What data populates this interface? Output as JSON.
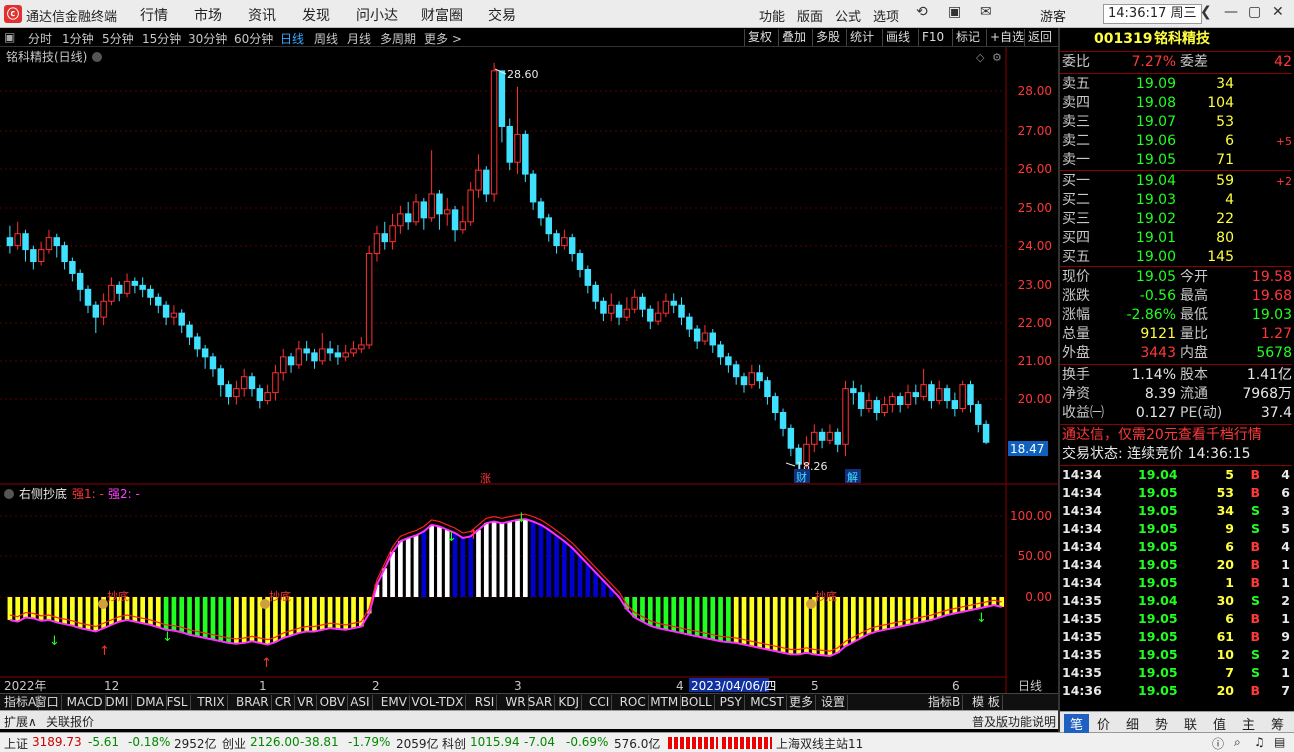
{
  "titlebar": {
    "app_title": "通达信金融终端",
    "menus": [
      "行情",
      "市场",
      "资讯",
      "发现",
      "问小达",
      "财富圈",
      "交易"
    ],
    "right_menus": [
      "功能",
      "版面",
      "公式",
      "选项"
    ],
    "user": "游客",
    "clock": "14:36:17 周三"
  },
  "period_bar": {
    "items": [
      "分时",
      "1分钟",
      "5分钟",
      "15分钟",
      "30分钟",
      "60分钟",
      "日线",
      "周线",
      "月线",
      "多周期",
      "更多 >"
    ],
    "active": "日线",
    "tools": [
      "复权",
      "叠加",
      "多股",
      "统计",
      "画线",
      "F10",
      "标记",
      "+自选",
      "返回"
    ]
  },
  "chart": {
    "stock_title": "铭科精技(日线)",
    "price_axis": [
      "28.00",
      "27.00",
      "26.00",
      "25.00",
      "24.00",
      "23.00",
      "22.00",
      "21.00",
      "20.00"
    ],
    "current_price_tag": "18.47",
    "high_label": "28.60",
    "low_label": "18.26",
    "mark_zhang": "涨",
    "mark_cai": "财",
    "mark_jie": "解",
    "indicator_title": "右侧抄底",
    "indicator_q1": "强1: -",
    "indicator_q2": "强2: -",
    "ind_axis": [
      "100.00",
      "50.00",
      "0.00"
    ],
    "chaodi": "抄底",
    "x_labels": [
      "2022年",
      "12",
      "1",
      "2",
      "3",
      "4",
      "5",
      "6"
    ],
    "date_cursor": "2023/04/06/四",
    "period_label": "日线",
    "candles": [
      [
        0,
        24.2,
        24.0,
        24.5,
        23.8
      ],
      [
        1,
        24.0,
        24.3,
        24.6,
        23.9
      ],
      [
        2,
        24.3,
        23.9,
        24.4,
        23.6
      ],
      [
        3,
        23.9,
        23.6,
        24.0,
        23.4
      ],
      [
        4,
        23.6,
        23.9,
        24.1,
        23.5
      ],
      [
        5,
        23.9,
        24.2,
        24.4,
        23.8
      ],
      [
        6,
        24.2,
        24.0,
        24.3,
        23.7
      ],
      [
        7,
        24.0,
        23.6,
        24.1,
        23.4
      ],
      [
        8,
        23.6,
        23.3,
        23.7,
        23.1
      ],
      [
        9,
        23.3,
        22.9,
        23.4,
        22.6
      ],
      [
        10,
        22.9,
        22.5,
        23.0,
        22.3
      ],
      [
        11,
        22.5,
        22.2,
        22.6,
        21.8
      ],
      [
        12,
        22.2,
        22.6,
        22.8,
        22.0
      ],
      [
        13,
        22.6,
        23.0,
        23.2,
        22.5
      ],
      [
        14,
        23.0,
        22.8,
        23.1,
        22.6
      ],
      [
        15,
        22.8,
        23.1,
        23.3,
        22.7
      ],
      [
        16,
        23.1,
        23.0,
        23.2,
        22.8
      ],
      [
        17,
        23.0,
        22.9,
        23.2,
        22.7
      ],
      [
        18,
        22.9,
        22.7,
        23.0,
        22.5
      ],
      [
        19,
        22.7,
        22.5,
        22.8,
        22.3
      ],
      [
        20,
        22.5,
        22.2,
        22.6,
        22.0
      ],
      [
        21,
        22.2,
        22.3,
        22.5,
        22.0
      ],
      [
        22,
        22.3,
        22.0,
        22.4,
        21.8
      ],
      [
        23,
        22.0,
        21.7,
        22.1,
        21.5
      ],
      [
        24,
        21.7,
        21.4,
        21.8,
        21.2
      ],
      [
        25,
        21.4,
        21.2,
        21.5,
        20.9
      ],
      [
        26,
        21.2,
        20.9,
        21.3,
        20.7
      ],
      [
        27,
        20.9,
        20.5,
        21.0,
        20.2
      ],
      [
        28,
        20.5,
        20.2,
        20.6,
        20.0
      ],
      [
        29,
        20.2,
        20.4,
        20.6,
        20.0
      ],
      [
        30,
        20.4,
        20.7,
        20.9,
        20.2
      ],
      [
        31,
        20.7,
        20.4,
        20.8,
        20.2
      ],
      [
        32,
        20.4,
        20.1,
        20.5,
        19.9
      ],
      [
        33,
        20.1,
        20.3,
        20.5,
        20.0
      ],
      [
        34,
        20.3,
        20.8,
        21.0,
        20.1
      ],
      [
        35,
        20.8,
        21.2,
        21.4,
        20.6
      ],
      [
        36,
        21.2,
        21.0,
        21.3,
        20.8
      ],
      [
        37,
        21.0,
        21.4,
        21.6,
        20.9
      ],
      [
        38,
        21.4,
        21.3,
        21.6,
        21.1
      ],
      [
        39,
        21.3,
        21.1,
        21.4,
        20.9
      ],
      [
        40,
        21.1,
        21.4,
        21.8,
        21.0
      ],
      [
        41,
        21.4,
        21.3,
        21.6,
        21.1
      ],
      [
        42,
        21.3,
        21.2,
        21.5,
        21.0
      ],
      [
        43,
        21.2,
        21.3,
        21.5,
        21.1
      ],
      [
        44,
        21.3,
        21.4,
        21.6,
        21.2
      ],
      [
        45,
        21.4,
        21.5,
        21.7,
        21.3
      ],
      [
        46,
        21.5,
        23.8,
        24.0,
        21.4
      ],
      [
        47,
        23.8,
        24.3,
        24.5,
        23.6
      ],
      [
        48,
        24.3,
        24.1,
        24.6,
        23.9
      ],
      [
        49,
        24.1,
        24.5,
        24.8,
        23.9
      ],
      [
        50,
        24.5,
        24.8,
        25.0,
        24.3
      ],
      [
        51,
        24.8,
        24.6,
        25.1,
        24.4
      ],
      [
        52,
        24.6,
        25.1,
        25.3,
        24.5
      ],
      [
        53,
        25.1,
        24.7,
        25.2,
        24.4
      ],
      [
        54,
        24.7,
        25.3,
        26.4,
        24.6
      ],
      [
        55,
        25.3,
        24.8,
        25.4,
        24.4
      ],
      [
        56,
        24.8,
        24.9,
        25.2,
        24.5
      ],
      [
        57,
        24.9,
        24.4,
        25.0,
        24.1
      ],
      [
        58,
        24.4,
        24.6,
        25.0,
        24.3
      ],
      [
        59,
        24.6,
        25.4,
        25.6,
        24.5
      ],
      [
        60,
        25.4,
        25.9,
        26.3,
        25.2
      ],
      [
        61,
        25.9,
        25.3,
        26.0,
        25.1
      ],
      [
        62,
        25.3,
        28.4,
        28.6,
        25.1
      ],
      [
        63,
        28.4,
        27.0,
        28.2,
        26.6
      ],
      [
        64,
        27.0,
        26.1,
        27.2,
        25.9
      ],
      [
        65,
        26.1,
        26.8,
        28.0,
        25.8
      ],
      [
        66,
        26.8,
        25.8,
        26.9,
        25.6
      ],
      [
        67,
        25.8,
        25.1,
        25.9,
        24.9
      ],
      [
        68,
        25.1,
        24.7,
        25.2,
        24.5
      ],
      [
        69,
        24.7,
        24.3,
        24.8,
        24.1
      ],
      [
        70,
        24.3,
        24.0,
        24.4,
        23.8
      ],
      [
        71,
        24.0,
        24.2,
        24.4,
        23.9
      ],
      [
        72,
        24.2,
        23.8,
        24.3,
        23.6
      ],
      [
        73,
        23.8,
        23.4,
        23.9,
        23.2
      ],
      [
        74,
        23.4,
        23.0,
        23.5,
        22.8
      ],
      [
        75,
        23.0,
        22.6,
        23.1,
        22.4
      ],
      [
        76,
        22.6,
        22.3,
        22.7,
        22.1
      ],
      [
        77,
        22.3,
        22.5,
        22.8,
        22.1
      ],
      [
        78,
        22.5,
        22.2,
        22.6,
        22.0
      ],
      [
        79,
        22.2,
        22.4,
        22.7,
        22.1
      ],
      [
        80,
        22.4,
        22.7,
        22.9,
        22.3
      ],
      [
        81,
        22.7,
        22.4,
        22.8,
        22.2
      ],
      [
        82,
        22.4,
        22.1,
        22.5,
        21.9
      ],
      [
        83,
        22.1,
        22.3,
        22.6,
        22.0
      ],
      [
        84,
        22.3,
        22.6,
        22.8,
        22.2
      ],
      [
        85,
        22.6,
        22.5,
        22.8,
        22.3
      ],
      [
        86,
        22.5,
        22.2,
        22.7,
        22.0
      ],
      [
        87,
        22.2,
        21.9,
        22.3,
        21.7
      ],
      [
        88,
        21.9,
        21.6,
        22.0,
        21.4
      ],
      [
        89,
        21.6,
        21.8,
        22.0,
        21.5
      ],
      [
        90,
        21.8,
        21.5,
        21.9,
        21.3
      ],
      [
        91,
        21.5,
        21.2,
        21.6,
        21.0
      ],
      [
        92,
        21.2,
        21.0,
        21.3,
        20.8
      ],
      [
        93,
        21.0,
        20.7,
        21.1,
        20.5
      ],
      [
        94,
        20.7,
        20.5,
        20.8,
        20.3
      ],
      [
        95,
        20.5,
        20.8,
        21.0,
        20.4
      ],
      [
        96,
        20.8,
        20.6,
        21.0,
        20.4
      ],
      [
        97,
        20.6,
        20.2,
        20.7,
        20.0
      ],
      [
        98,
        20.2,
        19.8,
        20.3,
        19.6
      ],
      [
        99,
        19.8,
        19.4,
        19.9,
        19.2
      ],
      [
        100,
        19.4,
        18.9,
        19.5,
        18.7
      ],
      [
        101,
        18.9,
        18.5,
        19.0,
        18.26
      ],
      [
        102,
        18.5,
        19.0,
        19.2,
        18.4
      ],
      [
        103,
        19.0,
        19.3,
        19.5,
        18.8
      ],
      [
        104,
        19.3,
        19.1,
        19.4,
        18.9
      ],
      [
        105,
        19.1,
        19.3,
        19.5,
        19.0
      ],
      [
        106,
        19.3,
        19.0,
        19.4,
        18.8
      ],
      [
        107,
        19.0,
        20.4,
        20.6,
        18.7
      ],
      [
        108,
        20.4,
        20.3,
        20.6,
        20.0
      ],
      [
        109,
        20.3,
        19.9,
        20.5,
        19.7
      ],
      [
        110,
        19.9,
        20.1,
        20.3,
        19.8
      ],
      [
        111,
        20.1,
        19.8,
        20.2,
        19.6
      ],
      [
        112,
        19.8,
        20.0,
        20.2,
        19.7
      ],
      [
        113,
        20.0,
        20.2,
        20.3,
        19.8
      ],
      [
        114,
        20.2,
        20.0,
        20.3,
        19.8
      ],
      [
        115,
        20.0,
        20.3,
        20.5,
        19.9
      ],
      [
        116,
        20.3,
        20.2,
        20.5,
        20.0
      ],
      [
        117,
        20.2,
        20.5,
        20.9,
        20.1
      ],
      [
        118,
        20.5,
        20.1,
        20.6,
        19.9
      ],
      [
        119,
        20.1,
        20.4,
        20.6,
        20.0
      ],
      [
        120,
        20.4,
        20.1,
        20.5,
        19.9
      ],
      [
        121,
        20.1,
        19.9,
        20.3,
        19.7
      ],
      [
        122,
        19.9,
        20.5,
        20.6,
        19.8
      ],
      [
        123,
        20.5,
        20.0,
        20.6,
        19.8
      ],
      [
        124,
        20.0,
        19.5,
        20.1,
        19.3
      ],
      [
        125,
        19.5,
        19.05,
        19.6,
        19.0
      ]
    ],
    "indicator": [
      -28,
      -30,
      -25,
      -26,
      -29,
      -28,
      -31,
      -33,
      -35,
      -38,
      -40,
      -42,
      -38,
      -34,
      -30,
      -28,
      -30,
      -32,
      -34,
      -37,
      -40,
      -41,
      -43,
      -46,
      -48,
      -50,
      -52,
      -54,
      -56,
      -57,
      -56,
      -54,
      -56,
      -58,
      -55,
      -50,
      -47,
      -44,
      -42,
      -42,
      -40,
      -38,
      -39,
      -40,
      -38,
      -36,
      -20,
      15,
      35,
      55,
      68,
      72,
      75,
      80,
      88,
      86,
      82,
      78,
      72,
      74,
      82,
      90,
      92,
      90,
      92,
      94,
      95,
      92,
      88,
      82,
      75,
      68,
      60,
      50,
      40,
      30,
      20,
      10,
      0,
      -15,
      -25,
      -30,
      -35,
      -38,
      -40,
      -42,
      -44,
      -46,
      -48,
      -50,
      -52,
      -54,
      -55,
      -56,
      -58,
      -60,
      -62,
      -64,
      -66,
      -68,
      -70,
      -70,
      -68,
      -70,
      -71,
      -72,
      -68,
      -60,
      -55,
      -50,
      -45,
      -42,
      -40,
      -38,
      -36,
      -34,
      -32,
      -30,
      -28,
      -25,
      -22,
      -20,
      -18,
      -16,
      -14,
      -12,
      -10,
      -12
    ]
  },
  "indicator_tabs": [
    "指标A",
    "窗口",
    "MACD",
    "DMI",
    "DMA",
    "FSL",
    "TRIX",
    "BRAR",
    "CR",
    "VR",
    "OBV",
    "ASI",
    "EMV",
    "VOL-TDX",
    "RSI",
    "WR",
    "SAR",
    "KDJ",
    "CCI",
    "ROC",
    "MTM",
    "BOLL",
    "PSY",
    "MCST",
    "更多",
    "设置"
  ],
  "indicator_b": "指标B",
  "template": "模 板",
  "subbar": {
    "expand": "扩展∧",
    "related": "关联报价",
    "right": "普及版功能说明"
  },
  "statusbar": {
    "sh_label": "上证",
    "sh_val": "3189.73",
    "sh_chg": "-5.61",
    "sh_pct": "-0.18%",
    "sh_amt": "2952亿",
    "cy_label": "创业",
    "cy_val": "2126.00",
    "cy_chg": "-38.81",
    "cy_pct": "-1.79%",
    "cy_amt": "2059亿",
    "kc_label": "科创",
    "kc_val": "1015.94",
    "kc_chg": "-7.04",
    "kc_pct": "-0.69%",
    "kc_amt": "576.0亿",
    "server": "上海双线主站11"
  },
  "quote": {
    "code": "001319",
    "name": "铭科精技",
    "weibi_label": "委比",
    "weibi": "7.27%",
    "weicha_label": "委差",
    "weicha": "42",
    "asks": [
      {
        "label": "卖五",
        "price": "19.09",
        "vol": "34",
        "chg": ""
      },
      {
        "label": "卖四",
        "price": "19.08",
        "vol": "104",
        "chg": ""
      },
      {
        "label": "卖三",
        "price": "19.07",
        "vol": "53",
        "chg": ""
      },
      {
        "label": "卖二",
        "price": "19.06",
        "vol": "6",
        "chg": "+5"
      },
      {
        "label": "卖一",
        "price": "19.05",
        "vol": "71",
        "chg": ""
      }
    ],
    "bids": [
      {
        "label": "买一",
        "price": "19.04",
        "vol": "59",
        "chg": "+2"
      },
      {
        "label": "买二",
        "price": "19.03",
        "vol": "4",
        "chg": ""
      },
      {
        "label": "买三",
        "price": "19.02",
        "vol": "22",
        "chg": ""
      },
      {
        "label": "买四",
        "price": "19.01",
        "vol": "80",
        "chg": ""
      },
      {
        "label": "买五",
        "price": "19.00",
        "vol": "145",
        "chg": ""
      }
    ],
    "stats": [
      {
        "l1": "现价",
        "v1": "19.05",
        "l2": "今开",
        "v2": "19.58",
        "c1": "grn",
        "c2": "red"
      },
      {
        "l1": "涨跌",
        "v1": "-0.56",
        "l2": "最高",
        "v2": "19.68",
        "c1": "grn",
        "c2": "red"
      },
      {
        "l1": "涨幅",
        "v1": "-2.86%",
        "l2": "最低",
        "v2": "19.03",
        "c1": "grn",
        "c2": "grn"
      },
      {
        "l1": "总量",
        "v1": "9121",
        "l2": "量比",
        "v2": "1.27",
        "c1": "yel",
        "c2": "red"
      },
      {
        "l1": "外盘",
        "v1": "3443",
        "l2": "内盘",
        "v2": "5678",
        "c1": "red",
        "c2": "grn"
      }
    ],
    "stats2": [
      {
        "l1": "换手",
        "v1": "1.14%",
        "l2": "股本",
        "v2": "1.41亿"
      },
      {
        "l1": "净资",
        "v1": "8.39",
        "l2": "流通",
        "v2": "7968万"
      },
      {
        "l1": "收益㈠",
        "v1": "0.127",
        "l2": "PE(动)",
        "v2": "37.4"
      }
    ],
    "promo": "通达信，仅需20元查看千档行情",
    "trade_status": "交易状态: 连续竞价 14:36:15",
    "ticks": [
      [
        "14:34",
        "19.04",
        "5",
        "B",
        "4"
      ],
      [
        "14:34",
        "19.05",
        "53",
        "B",
        "6"
      ],
      [
        "14:34",
        "19.05",
        "34",
        "S",
        "3"
      ],
      [
        "14:34",
        "19.05",
        "9",
        "S",
        "5"
      ],
      [
        "14:34",
        "19.05",
        "6",
        "B",
        "4"
      ],
      [
        "14:34",
        "19.05",
        "20",
        "B",
        "1"
      ],
      [
        "14:34",
        "19.05",
        "1",
        "B",
        "1"
      ],
      [
        "14:35",
        "19.04",
        "30",
        "S",
        "2"
      ],
      [
        "14:35",
        "19.05",
        "6",
        "B",
        "1"
      ],
      [
        "14:35",
        "19.05",
        "61",
        "B",
        "9"
      ],
      [
        "14:35",
        "19.05",
        "10",
        "S",
        "2"
      ],
      [
        "14:35",
        "19.05",
        "7",
        "S",
        "1"
      ],
      [
        "14:36",
        "19.05",
        "20",
        "B",
        "7"
      ]
    ],
    "tabs": [
      "笔",
      "价",
      "细",
      "势",
      "联",
      "值",
      "主",
      "筹"
    ]
  }
}
